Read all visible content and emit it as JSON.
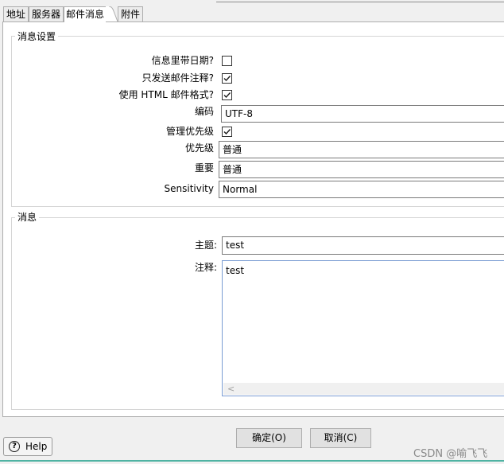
{
  "tabs": [
    {
      "label": "地址",
      "active": false
    },
    {
      "label": "服务器",
      "active": false
    },
    {
      "label": "邮件消息",
      "active": true
    },
    {
      "label": "附件",
      "active": false
    }
  ],
  "settings": {
    "group_title": "消息设置",
    "include_date_label": "信息里带日期?",
    "include_date_checked": false,
    "only_comments_label": "只发送邮件注释?",
    "only_comments_checked": true,
    "html_format_label": "使用 HTML 邮件格式?",
    "html_format_checked": true,
    "encoding_label": "编码",
    "encoding_value": "UTF-8",
    "manage_priority_label": "管理优先级",
    "manage_priority_checked": true,
    "priority_label": "优先级",
    "priority_value": "普通",
    "importance_label": "重要",
    "importance_value": "普通",
    "sensitivity_label": "Sensitivity",
    "sensitivity_value": "Normal"
  },
  "message": {
    "group_title": "消息",
    "subject_label": "主题:",
    "subject_value": "test",
    "comment_label": "注释:",
    "comment_value": "test",
    "scroll_left_glyph": "<"
  },
  "buttons": {
    "help_label": "Help",
    "help_icon_glyph": "?",
    "ok_label": "确定(O)",
    "cancel_label": "取消(C)"
  },
  "watermark": "CSDN @喻飞飞",
  "colors": {
    "focus_border": "#7a9cd3",
    "accent_line": "#4fb3a3"
  }
}
